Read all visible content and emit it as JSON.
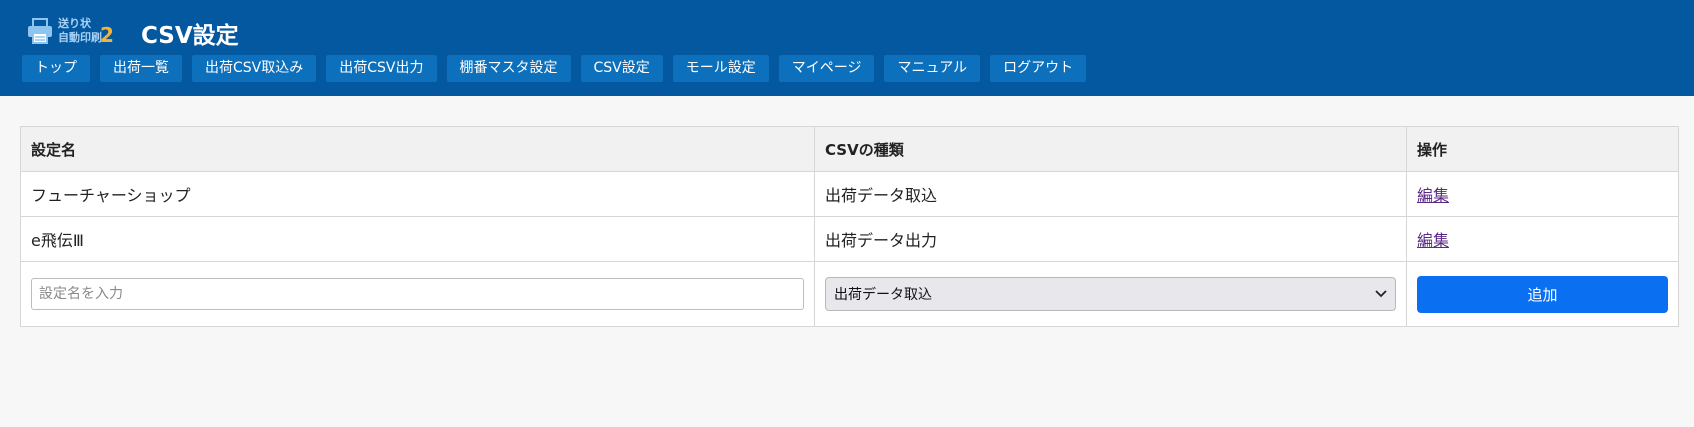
{
  "app": {
    "logo_line1": "送り状",
    "logo_line2": "自動印刷",
    "logo_number": "2",
    "page_title": "CSV設定"
  },
  "nav": {
    "items": [
      {
        "label": "トップ"
      },
      {
        "label": "出荷一覧"
      },
      {
        "label": "出荷CSV取込み"
      },
      {
        "label": "出荷CSV出力"
      },
      {
        "label": "棚番マスタ設定"
      },
      {
        "label": "CSV設定"
      },
      {
        "label": "モール設定"
      },
      {
        "label": "マイページ"
      },
      {
        "label": "マニュアル"
      },
      {
        "label": "ログアウト"
      }
    ]
  },
  "table": {
    "headers": {
      "name": "設定名",
      "type": "CSVの種類",
      "actions": "操作"
    },
    "rows": [
      {
        "name": "フューチャーショップ",
        "type": "出荷データ取込",
        "action": "編集"
      },
      {
        "name": "e飛伝Ⅲ",
        "type": "出荷データ出力",
        "action": "編集"
      }
    ],
    "new_row": {
      "name_value": "",
      "name_placeholder": "設定名を入力",
      "type_selected": "出荷データ取込",
      "add_label": "追加"
    }
  },
  "colors": {
    "header_bg": "#0458a0",
    "nav_button_bg": "#0c70bc",
    "add_button_bg": "#0b6ff2",
    "link_color": "#5b2a86"
  }
}
